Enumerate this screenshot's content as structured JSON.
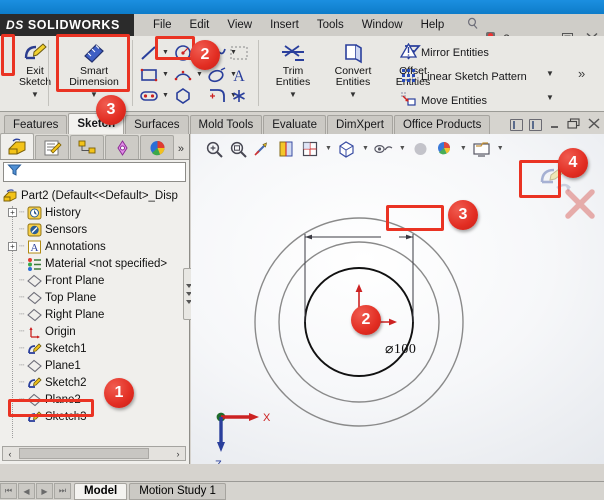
{
  "app": {
    "brand": "SOLIDWORKS",
    "brand_mark": "DS",
    "menu": [
      "File",
      "Edit",
      "View",
      "Insert",
      "Tools",
      "Window",
      "Help"
    ],
    "pin_icon": "pushpin-icon",
    "window_controls": {
      "traffic_light": "traffic-light-icon",
      "help": "?",
      "dropdown": "▾",
      "minimize": "–",
      "restore": "□",
      "close": "✕"
    }
  },
  "ribbon": {
    "exit_sketch": {
      "label_line1": "Exit",
      "label_line2": "Sketch",
      "icon": "exit-sketch-icon"
    },
    "smart_dimension": {
      "label_line1": "Smart",
      "label_line2": "Dimension",
      "icon": "smart-dimension-icon"
    },
    "sketch_entities": [
      {
        "name": "line-icon"
      },
      {
        "name": "circle-icon"
      },
      {
        "name": "rectangle-icon"
      },
      {
        "name": "arc-icon"
      },
      {
        "name": "spline-icon"
      },
      {
        "name": "text-icon"
      },
      {
        "name": "slot-icon"
      },
      {
        "name": "polygon-icon"
      },
      {
        "name": "sketch-fillet-icon"
      },
      {
        "name": "point-icon"
      },
      {
        "name": "display-delete-relations-icon"
      }
    ],
    "trim_entities": {
      "label_line1": "Trim",
      "label_line2": "Entities",
      "icon": "trim-entities-icon"
    },
    "convert_entities": {
      "label_line1": "Convert",
      "label_line2": "Entities",
      "icon": "convert-entities-icon"
    },
    "offset_entities": {
      "label_line1": "Offset",
      "label_line2": "Entities",
      "icon": "offset-entities-icon"
    },
    "mirror_entities": {
      "label": "Mirror Entities",
      "icon": "mirror-entities-icon"
    },
    "linear_sketch_pattern": {
      "label": "Linear Sketch Pattern",
      "icon": "linear-pattern-icon"
    },
    "move_entities": {
      "label": "Move Entities",
      "icon": "move-entities-icon"
    },
    "overflow": "»"
  },
  "command_tabs": [
    {
      "label": "Features",
      "active": false
    },
    {
      "label": "Sketch",
      "active": true
    },
    {
      "label": "Surfaces",
      "active": false
    },
    {
      "label": "Mold Tools",
      "active": false
    },
    {
      "label": "Evaluate",
      "active": false
    },
    {
      "label": "DimXpert",
      "active": false
    },
    {
      "label": "Office Products",
      "active": false
    }
  ],
  "document_controls": {
    "restore_down": "–",
    "maximize": "❐",
    "close": "✕"
  },
  "manager_tabs": [
    {
      "name": "feature-manager-tab",
      "active": true
    },
    {
      "name": "property-manager-tab",
      "active": false
    },
    {
      "name": "configuration-manager-tab",
      "active": false
    },
    {
      "name": "dimxpert-manager-tab",
      "active": false
    },
    {
      "name": "display-manager-tab",
      "active": false
    }
  ],
  "manager_more": "»",
  "filter": {
    "icon": "filter-icon",
    "value": ""
  },
  "tree": {
    "root": "Part2  (Default<<Default>_Disp",
    "root_icon": "part-icon",
    "items": [
      {
        "label": "History",
        "icon": "history-icon",
        "expandable": true,
        "indent": 1
      },
      {
        "label": "Sensors",
        "icon": "sensors-icon",
        "expandable": false,
        "indent": 1
      },
      {
        "label": "Annotations",
        "icon": "annotations-icon",
        "expandable": true,
        "indent": 1
      },
      {
        "label": "Material <not specified>",
        "icon": "material-icon",
        "expandable": false,
        "indent": 1
      },
      {
        "label": "Front Plane",
        "icon": "plane-icon",
        "expandable": false,
        "indent": 1
      },
      {
        "label": "Top Plane",
        "icon": "plane-icon",
        "expandable": false,
        "indent": 1
      },
      {
        "label": "Right Plane",
        "icon": "plane-icon",
        "expandable": false,
        "indent": 1
      },
      {
        "label": "Origin",
        "icon": "origin-icon",
        "expandable": false,
        "indent": 1
      },
      {
        "label": "Sketch1",
        "icon": "sketch-icon",
        "expandable": false,
        "indent": 1
      },
      {
        "label": "Plane1",
        "icon": "plane-icon",
        "expandable": false,
        "indent": 1
      },
      {
        "label": "Sketch2",
        "icon": "sketch-icon",
        "expandable": false,
        "indent": 1
      },
      {
        "label": "Plane2",
        "icon": "plane-icon",
        "expandable": false,
        "indent": 1,
        "highlighted": true
      },
      {
        "label": "Sketch3",
        "icon": "sketch-icon",
        "expandable": false,
        "indent": 1
      }
    ]
  },
  "tree_scroll": {
    "left_arrow": "‹",
    "right_arrow": "›"
  },
  "heads_up_toolbar": [
    {
      "name": "zoom-to-fit-icon",
      "caret": false
    },
    {
      "name": "zoom-to-area-icon",
      "caret": false
    },
    {
      "name": "previous-view-icon",
      "caret": false
    },
    {
      "name": "section-view-icon",
      "caret": false
    },
    {
      "name": "view-orientation-icon",
      "caret": true
    },
    {
      "name": "display-style-icon",
      "caret": true
    },
    {
      "name": "hide-show-items-icon",
      "caret": true
    },
    {
      "name": "edit-appearance-icon",
      "caret": false
    },
    {
      "name": "apply-scene-icon",
      "caret": true
    },
    {
      "name": "view-settings-icon",
      "caret": true
    }
  ],
  "sketch_confirm": {
    "exit_sketch_icon": "exit-sketch-confirm-icon",
    "cancel_icon": "cancel-sketch-icon"
  },
  "graphics": {
    "dimension": {
      "symbol": "⌀",
      "value": "100",
      "full": "⌀100"
    },
    "triad": {
      "x_label": "X",
      "z_label": "Z"
    },
    "circles": [
      {
        "name": "outer-construction-circle",
        "r": 104,
        "color": "#8a8a8a"
      },
      {
        "name": "middle-construction-circle",
        "r": 80,
        "color": "#8a8a8a"
      },
      {
        "name": "active-sketch-circle",
        "r": 54,
        "color": "#111111"
      }
    ]
  },
  "status_bar": {
    "nav": [
      "⏮",
      "◀",
      "▶",
      "⏭"
    ],
    "tabs": [
      {
        "label": "Model",
        "active": true
      },
      {
        "label": "Motion Study 1",
        "active": false
      }
    ]
  },
  "annotations": {
    "badges": [
      {
        "number": "1",
        "target": "plane2-tree-item"
      },
      {
        "number": "2",
        "target": "circle-tool"
      },
      {
        "number": "3",
        "target": "smart-dimension"
      },
      {
        "number": "4",
        "target": "exit-sketch-corner"
      }
    ],
    "badge_color": "#e22d22",
    "highlight_color": "#ea3323"
  }
}
